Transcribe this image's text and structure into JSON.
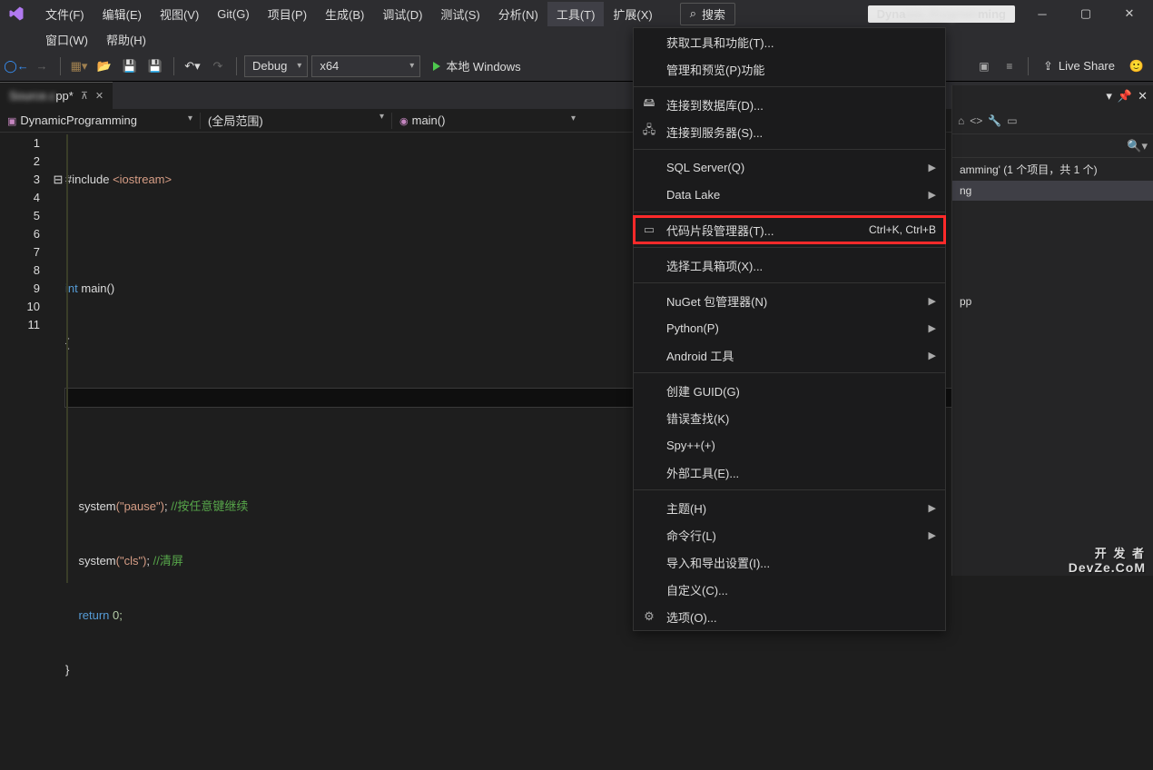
{
  "menubar": {
    "items": [
      "文件(F)",
      "编辑(E)",
      "视图(V)",
      "Git(G)",
      "项目(P)",
      "生成(B)",
      "调试(D)",
      "测试(S)",
      "分析(N)",
      "工具(T)",
      "扩展(X)"
    ],
    "active_index": 9,
    "row2": [
      "窗口(W)",
      "帮助(H)"
    ],
    "search_placeholder": "搜索",
    "solution_badge_left": "Dyna",
    "solution_badge_right": "ming"
  },
  "toolbar": {
    "config": "Debug",
    "platform": "x64",
    "start_label": "本地 Windows",
    "liveshare": "Live Share"
  },
  "tab": {
    "filename_visible": "pp",
    "filename_suffix": "*"
  },
  "codebar": {
    "project": "DynamicProgramming",
    "scope": "(全局范围)",
    "func": "main()"
  },
  "code": {
    "line_numbers": [
      "1",
      "2",
      "3",
      "4",
      "5",
      "6",
      "7",
      "8",
      "9",
      "10",
      "11"
    ],
    "lines": {
      "l1_include": "#include",
      "l1_header": "<iostream>",
      "l3_int": "int",
      "l3_main": "main",
      "l3_paren": "()",
      "l4_brace": "{",
      "l7_system": "system",
      "l7_arg": "(\"pause\")",
      "l7_semi": ";",
      "l7_comment": "//按任意键继续",
      "l8_system": "system",
      "l8_arg": "(\"cls\")",
      "l8_semi": ";",
      "l8_comment": "//清屏",
      "l9_return": "return",
      "l9_val": " 0;",
      "l10_brace": "}"
    }
  },
  "tools_menu": {
    "items": [
      {
        "label": "获取工具和功能(T)...",
        "icon": "",
        "submenu": false
      },
      {
        "label": "管理和预览(P)功能",
        "icon": "",
        "submenu": false
      },
      {
        "sep": true
      },
      {
        "label": "连接到数据库(D)...",
        "icon": "db",
        "submenu": false
      },
      {
        "label": "连接到服务器(S)...",
        "icon": "server",
        "submenu": false
      },
      {
        "sep": true
      },
      {
        "label": "SQL Server(Q)",
        "icon": "",
        "submenu": true
      },
      {
        "label": "Data Lake",
        "icon": "",
        "submenu": true
      },
      {
        "sep": true
      },
      {
        "label": "代码片段管理器(T)...",
        "icon": "snippet",
        "shortcut": "Ctrl+K, Ctrl+B",
        "highlight": true
      },
      {
        "sep": true
      },
      {
        "label": "选择工具箱项(X)...",
        "icon": "",
        "submenu": false
      },
      {
        "sep": true
      },
      {
        "label": "NuGet 包管理器(N)",
        "icon": "",
        "submenu": true
      },
      {
        "label": "Python(P)",
        "icon": "",
        "submenu": true
      },
      {
        "label": "Android 工具",
        "icon": "",
        "submenu": true
      },
      {
        "sep": true
      },
      {
        "label": "创建 GUID(G)",
        "icon": "",
        "submenu": false
      },
      {
        "label": "错误查找(K)",
        "icon": "",
        "submenu": false
      },
      {
        "label": "Spy++(+)",
        "icon": "",
        "submenu": false
      },
      {
        "label": "外部工具(E)...",
        "icon": "",
        "submenu": false
      },
      {
        "sep": true
      },
      {
        "label": "主题(H)",
        "icon": "",
        "submenu": true
      },
      {
        "label": "命令行(L)",
        "icon": "",
        "submenu": true
      },
      {
        "label": "导入和导出设置(I)...",
        "icon": "",
        "submenu": false
      },
      {
        "label": "自定义(C)...",
        "icon": "",
        "submenu": false
      },
      {
        "label": "选项(O)...",
        "icon": "gear",
        "submenu": false
      }
    ]
  },
  "solution_explorer": {
    "summary_left": "amming' (1 个项目，共 1 个)",
    "item1": "ng",
    "item2": "pp"
  },
  "watermark": {
    "l1": "开 发 者",
    "l2": "DevZe.CoM"
  }
}
